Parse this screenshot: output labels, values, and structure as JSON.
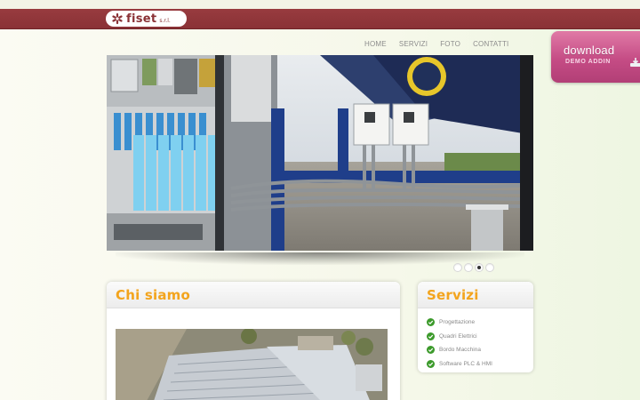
{
  "header": {
    "logo_text": "fiset",
    "logo_sub": "s.r.l."
  },
  "nav": {
    "items": [
      "HOME",
      "SERVIZI",
      "FOTO",
      "CONTATTI"
    ]
  },
  "download": {
    "title": "download",
    "subtitle": "DEMO ADDIN"
  },
  "slider": {
    "active_index": 2,
    "dots": [
      1,
      2,
      3,
      4
    ]
  },
  "chi_siamo": {
    "title": "Chi siamo"
  },
  "servizi": {
    "title": "Servizi",
    "items": [
      "Progettazione",
      "Quadri Elettrici",
      "Bordo Macchina",
      "Software PLC & HMI"
    ]
  },
  "colors": {
    "header_bar": "#8a3236",
    "accent_title": "#f3a41d",
    "download_bg": "#c54c85",
    "check_green": "#3c9a2b"
  }
}
